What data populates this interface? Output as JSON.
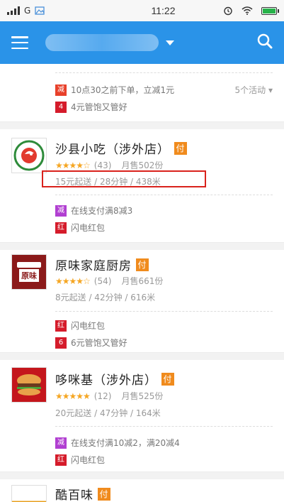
{
  "status_bar": {
    "carrier": "G",
    "time": "11:22"
  },
  "app_bar": {
    "location": ""
  },
  "shops": [
    {
      "promos": [
        {
          "tag": "减",
          "text": "10点30之前下单，立减1元"
        },
        {
          "tag": "4",
          "text": "4元管饱又管好"
        }
      ],
      "activities": "5个活动"
    },
    {
      "name": "沙县小吃（涉外店）",
      "pay": "付",
      "stars": "★★★★☆",
      "reviews": "(43)",
      "sales": "月售502份",
      "delivery": "15元起送 / 28分钟 / 438米",
      "promos": [
        {
          "tag": "减",
          "text": "在线支付满8减3"
        },
        {
          "tag": "红",
          "text": "闪电红包"
        }
      ]
    },
    {
      "name": "原味家庭厨房",
      "pay": "付",
      "stars": "★★★★☆",
      "reviews": "(54)",
      "sales": "月售661份",
      "delivery": "8元起送 / 42分钟 / 616米",
      "logo_text": "原味",
      "promos": [
        {
          "tag": "红",
          "text": "闪电红包"
        },
        {
          "tag": "6",
          "text": "6元管饱又管好"
        }
      ]
    },
    {
      "name": "哆咪基（涉外店）",
      "pay": "付",
      "stars": "★★★★★",
      "reviews": "(12)",
      "sales": "月售525份",
      "delivery": "20元起送 / 47分钟 / 164米",
      "promos": [
        {
          "tag": "减",
          "text": "在线支付满10减2，满20减4"
        },
        {
          "tag": "红",
          "text": "闪电红包"
        }
      ]
    },
    {
      "name": "酷百味",
      "pay": "付"
    }
  ]
}
